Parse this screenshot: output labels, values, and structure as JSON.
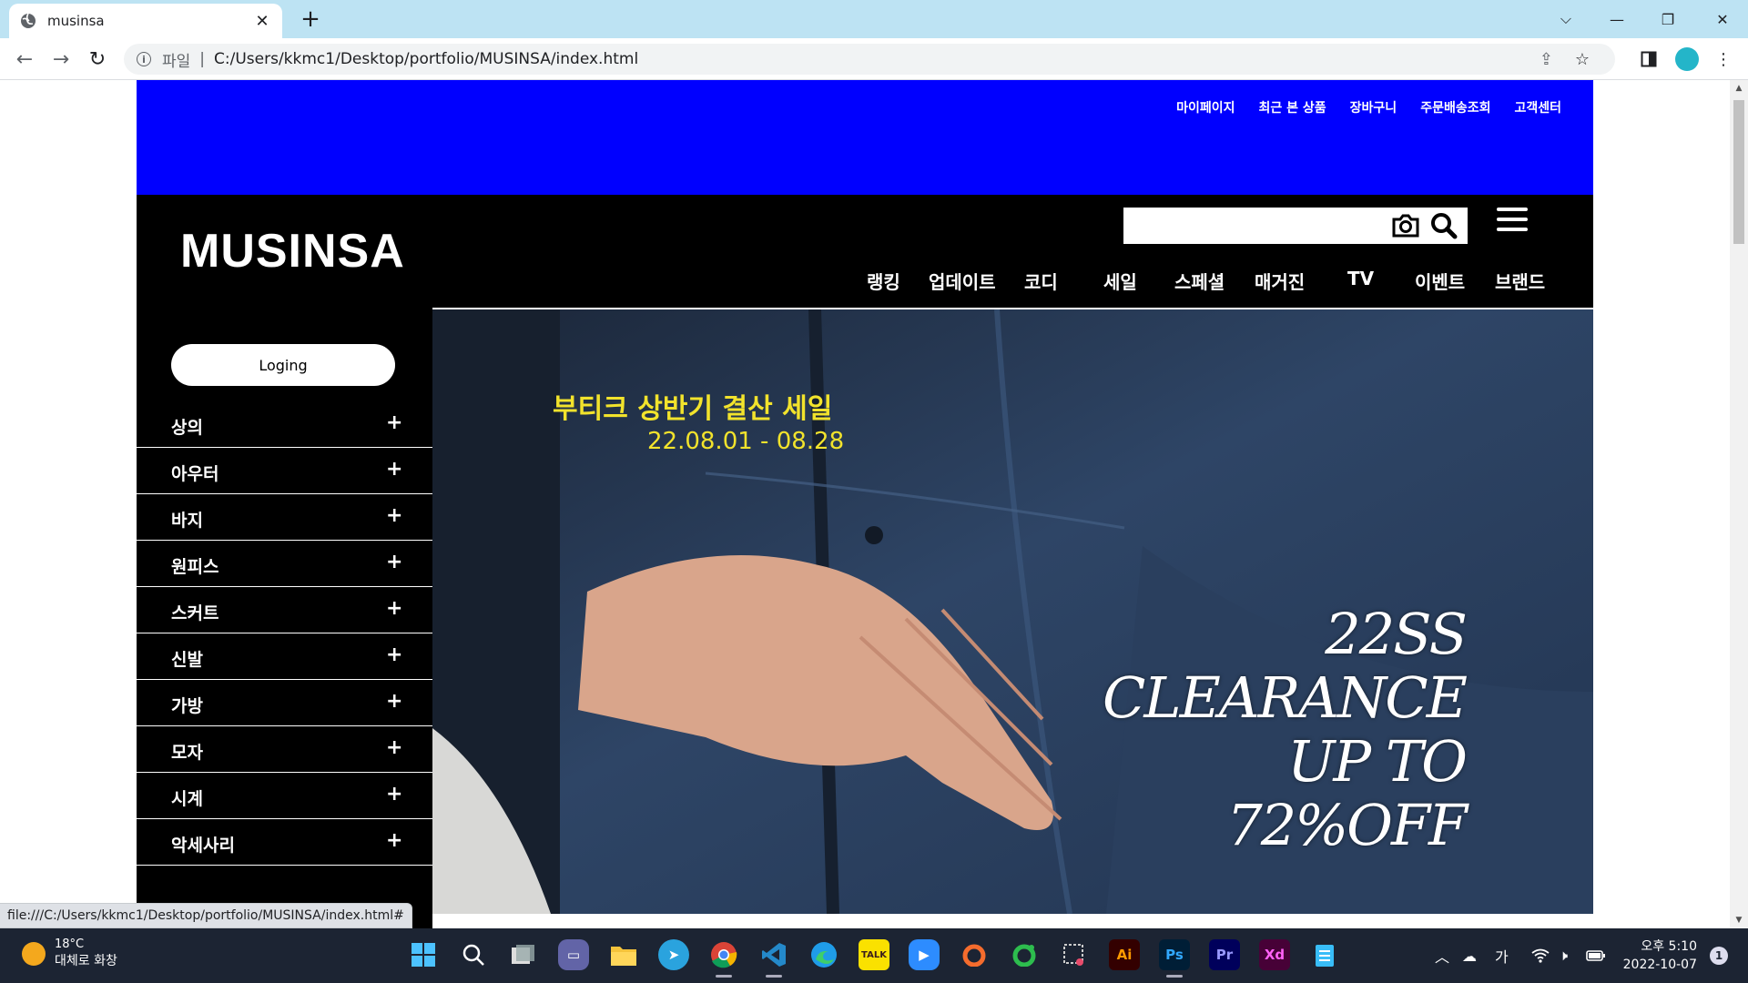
{
  "browser": {
    "tab_title": "musinsa",
    "scheme_label": "파일",
    "separator": "|",
    "url": "C:/Users/kkmc1/Desktop/portfolio/MUSINSA/index.html",
    "status_url": "file:///C:/Users/kkmc1/Desktop/portfolio/MUSINSA/index.html#"
  },
  "site": {
    "top_links": [
      "마이페이지",
      "최근 본 상품",
      "장바구니",
      "주문배송조회",
      "고객센터"
    ],
    "logo": "MUSINSA",
    "search_value": "",
    "gnb": [
      "랭킹",
      "업데이트",
      "코디",
      "세일",
      "스페셜",
      "매거진",
      "TV",
      "이벤트",
      "브랜드"
    ],
    "login_label": "Loging",
    "categories": [
      "상의",
      "아우터",
      "바지",
      "원피스",
      "스커트",
      "신발",
      "가방",
      "모자",
      "시계",
      "악세사리"
    ],
    "expand_symbol": "+",
    "banner": {
      "headline": "부티크 상반기 결산 세일",
      "dates": "22.08.01 - 08.28",
      "promo_lines": [
        "22SS",
        "CLEARANCE",
        "UP TO",
        "72%OFF"
      ]
    },
    "colors": {
      "topbar": "#0000ff",
      "header": "#000000",
      "banner_text": "#f2e32c"
    }
  },
  "taskbar": {
    "temperature": "18°C",
    "weather": "대체로 화창",
    "ime": "가",
    "time": "오후 5:10",
    "date": "2022-10-07",
    "notifications": "1",
    "apps": [
      "windows-start",
      "search",
      "task-view",
      "teams-chat",
      "file-explorer",
      "telegram",
      "chrome",
      "vscode",
      "edge",
      "kakaotalk",
      "zoom",
      "origin",
      "line",
      "snipping-tool",
      "illustrator",
      "photoshop",
      "premiere",
      "xd",
      "notepad"
    ],
    "app_labels": {
      "illustrator": "Ai",
      "photoshop": "Ps",
      "premiere": "Pr",
      "xd": "Xd"
    }
  }
}
